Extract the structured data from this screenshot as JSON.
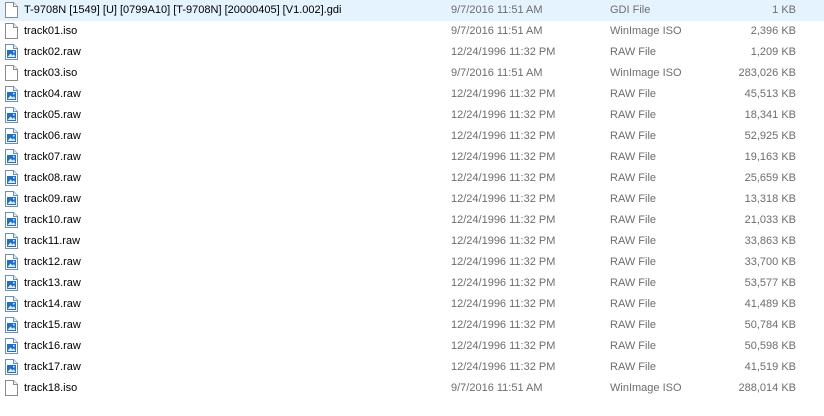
{
  "files": [
    {
      "name": "T-9708N [1549] [U] [0799A10] [T-9708N] [20000405] [V1.002].gdi",
      "date": "9/7/2016 11:51 AM",
      "type": "GDI File",
      "size": "1 KB",
      "icon": "generic-file-icon"
    },
    {
      "name": "track01.iso",
      "date": "9/7/2016 11:51 AM",
      "type": "WinImage ISO",
      "size": "2,396 KB",
      "icon": "generic-file-icon"
    },
    {
      "name": "track02.raw",
      "date": "12/24/1996 11:32 PM",
      "type": "RAW File",
      "size": "1,209 KB",
      "icon": "raw-image-file-icon"
    },
    {
      "name": "track03.iso",
      "date": "9/7/2016 11:51 AM",
      "type": "WinImage ISO",
      "size": "283,026 KB",
      "icon": "generic-file-icon"
    },
    {
      "name": "track04.raw",
      "date": "12/24/1996 11:32 PM",
      "type": "RAW File",
      "size": "45,513 KB",
      "icon": "raw-image-file-icon"
    },
    {
      "name": "track05.raw",
      "date": "12/24/1996 11:32 PM",
      "type": "RAW File",
      "size": "18,341 KB",
      "icon": "raw-image-file-icon"
    },
    {
      "name": "track06.raw",
      "date": "12/24/1996 11:32 PM",
      "type": "RAW File",
      "size": "52,925 KB",
      "icon": "raw-image-file-icon"
    },
    {
      "name": "track07.raw",
      "date": "12/24/1996 11:32 PM",
      "type": "RAW File",
      "size": "19,163 KB",
      "icon": "raw-image-file-icon"
    },
    {
      "name": "track08.raw",
      "date": "12/24/1996 11:32 PM",
      "type": "RAW File",
      "size": "25,659 KB",
      "icon": "raw-image-file-icon"
    },
    {
      "name": "track09.raw",
      "date": "12/24/1996 11:32 PM",
      "type": "RAW File",
      "size": "13,318 KB",
      "icon": "raw-image-file-icon"
    },
    {
      "name": "track10.raw",
      "date": "12/24/1996 11:32 PM",
      "type": "RAW File",
      "size": "21,033 KB",
      "icon": "raw-image-file-icon"
    },
    {
      "name": "track11.raw",
      "date": "12/24/1996 11:32 PM",
      "type": "RAW File",
      "size": "33,863 KB",
      "icon": "raw-image-file-icon"
    },
    {
      "name": "track12.raw",
      "date": "12/24/1996 11:32 PM",
      "type": "RAW File",
      "size": "33,700 KB",
      "icon": "raw-image-file-icon"
    },
    {
      "name": "track13.raw",
      "date": "12/24/1996 11:32 PM",
      "type": "RAW File",
      "size": "53,577 KB",
      "icon": "raw-image-file-icon"
    },
    {
      "name": "track14.raw",
      "date": "12/24/1996 11:32 PM",
      "type": "RAW File",
      "size": "41,489 KB",
      "icon": "raw-image-file-icon"
    },
    {
      "name": "track15.raw",
      "date": "12/24/1996 11:32 PM",
      "type": "RAW File",
      "size": "50,784 KB",
      "icon": "raw-image-file-icon"
    },
    {
      "name": "track16.raw",
      "date": "12/24/1996 11:32 PM",
      "type": "RAW File",
      "size": "50,598 KB",
      "icon": "raw-image-file-icon"
    },
    {
      "name": "track17.raw",
      "date": "12/24/1996 11:32 PM",
      "type": "RAW File",
      "size": "41,519 KB",
      "icon": "raw-image-file-icon"
    },
    {
      "name": "track18.iso",
      "date": "9/7/2016 11:51 AM",
      "type": "WinImage ISO",
      "size": "288,014 KB",
      "icon": "generic-file-icon"
    }
  ],
  "colors": {
    "text": "#000000",
    "meta_text": "#6d6d6d",
    "hover": "#e5f3ff",
    "raw_icon_blue": "#1f6fc5"
  }
}
